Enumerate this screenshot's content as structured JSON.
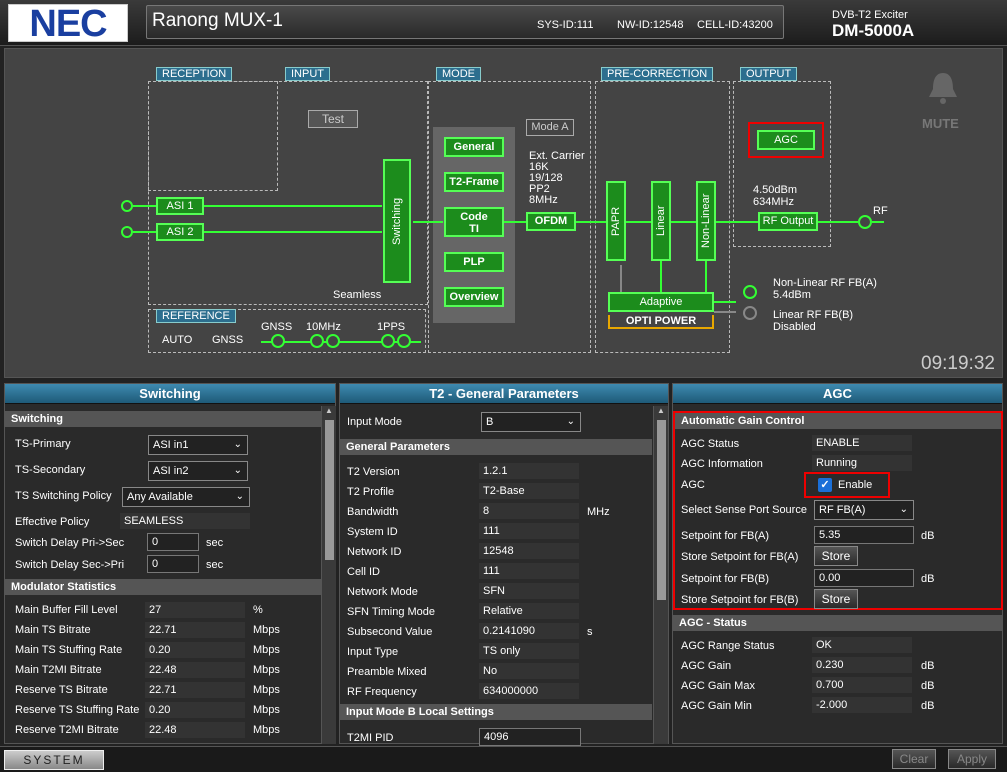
{
  "header": {
    "logo": "NEC",
    "site": "Ranong MUX-1",
    "sys_id": "SYS-ID:111",
    "nw_id": "NW-ID:12548",
    "cell_id": "CELL-ID:43200",
    "model_sub": "DVB-T2 Exciter",
    "model": "DM-5000A"
  },
  "diagram": {
    "sections": {
      "reception": "RECEPTION",
      "input": "INPUT",
      "mode": "MODE",
      "precorrection": "PRE-CORRECTION",
      "output": "OUTPUT",
      "reference": "REFERENCE"
    },
    "test": "Test",
    "asi1": "ASI 1",
    "asi2": "ASI 2",
    "switching": "Switching",
    "seamless": "Seamless",
    "mode_a": "Mode A",
    "general": "General",
    "t2frame": "T2-Frame",
    "code_ti_1": "Code",
    "code_ti_2": "TI",
    "plp": "PLP",
    "overview": "Overview",
    "carrier": [
      "Ext. Carrier",
      "16K",
      "19/128",
      "PP2",
      "8MHz"
    ],
    "ofdm": "OFDM",
    "papr": "PAPR",
    "linear": "Linear",
    "nonlinear": "Non-Linear",
    "adaptive": "Adaptive",
    "optipower": "OPTI POWER",
    "agc": "AGC",
    "out_level": "4.50dBm",
    "out_freq": "634MHz",
    "rf_output": "RF Output",
    "rf": "RF",
    "nl_fb": "Non-Linear RF FB(A)",
    "nl_fb_level": "5.4dBm",
    "l_fb": "Linear RF FB(B)",
    "l_fb_state": "Disabled",
    "mute": "MUTE",
    "ref_auto": "AUTO",
    "ref_gnss": "GNSS",
    "in_gnss": "GNSS",
    "in_10mhz": "10MHz",
    "in_1pps": "1PPS",
    "clock": "09:19:32"
  },
  "switching": {
    "title": "Switching",
    "section": "Switching",
    "ts_primary_label": "TS-Primary",
    "ts_primary": "ASI in1",
    "ts_secondary_label": "TS-Secondary",
    "ts_secondary": "ASI in2",
    "policy_label": "TS Switching Policy",
    "policy": "Any Available",
    "eff_policy_label": "Effective Policy",
    "eff_policy": "SEAMLESS",
    "delay_ps_label": "Switch Delay Pri->Sec",
    "delay_ps": "0",
    "delay_ps_unit": "sec",
    "delay_sp_label": "Switch Delay Sec->Pri",
    "delay_sp": "0",
    "delay_sp_unit": "sec",
    "stats_section": "Modulator Statistics",
    "stats": [
      {
        "label": "Main Buffer Fill Level",
        "value": "27",
        "unit": "%"
      },
      {
        "label": "Main TS Bitrate",
        "value": "22.71",
        "unit": "Mbps"
      },
      {
        "label": "Main TS Stuffing Rate",
        "value": "0.20",
        "unit": "Mbps"
      },
      {
        "label": "Main T2MI Bitrate",
        "value": "22.48",
        "unit": "Mbps"
      },
      {
        "label": "Reserve TS Bitrate",
        "value": "22.71",
        "unit": "Mbps"
      },
      {
        "label": "Reserve TS Stuffing Rate",
        "value": "0.20",
        "unit": "Mbps"
      },
      {
        "label": "Reserve T2MI Bitrate",
        "value": "22.48",
        "unit": "Mbps"
      }
    ]
  },
  "t2": {
    "title": "T2 - General Parameters",
    "input_mode_label": "Input Mode",
    "input_mode": "B",
    "section": "General Parameters",
    "params": [
      {
        "label": "T2 Version",
        "value": "1.2.1",
        "unit": ""
      },
      {
        "label": "T2 Profile",
        "value": "T2-Base",
        "unit": ""
      },
      {
        "label": "Bandwidth",
        "value": "8",
        "unit": "MHz"
      },
      {
        "label": "System ID",
        "value": "111",
        "unit": ""
      },
      {
        "label": "Network ID",
        "value": "12548",
        "unit": ""
      },
      {
        "label": "Cell ID",
        "value": "111",
        "unit": ""
      },
      {
        "label": "Network Mode",
        "value": "SFN",
        "unit": ""
      },
      {
        "label": "SFN Timing Mode",
        "value": "Relative",
        "unit": ""
      },
      {
        "label": "Subsecond Value",
        "value": "0.2141090",
        "unit": "s"
      },
      {
        "label": "Input Type",
        "value": "TS only",
        "unit": ""
      },
      {
        "label": "Preamble Mixed",
        "value": "No",
        "unit": ""
      },
      {
        "label": "RF Frequency",
        "value": "634000000",
        "unit": ""
      }
    ],
    "section2": "Input Mode B Local Settings",
    "t2mi_pid_label": "T2MI PID",
    "t2mi_pid": "4096"
  },
  "agc": {
    "title": "AGC",
    "section": "Automatic Gain Control",
    "status_label": "AGC Status",
    "status": "ENABLE",
    "info_label": "AGC Information",
    "info": "Running",
    "agc_label": "AGC",
    "enable_label": "Enable",
    "sense_label": "Select Sense Port Source",
    "sense": "RF FB(A)",
    "sp_a_label": "Setpoint for FB(A)",
    "sp_a": "5.35",
    "sp_a_unit": "dB",
    "store_a_label": "Store Setpoint for FB(A)",
    "store": "Store",
    "sp_b_label": "Setpoint for FB(B)",
    "sp_b": "0.00",
    "sp_b_unit": "dB",
    "store_b_label": "Store Setpoint for FB(B)",
    "status_section": "AGC - Status",
    "range_label": "AGC Range Status",
    "range": "OK",
    "gain_label": "AGC Gain",
    "gain": "0.230",
    "gain_unit": "dB",
    "gmax_label": "AGC Gain Max",
    "gmax": "0.700",
    "gmax_unit": "dB",
    "gmin_label": "AGC Gain Min",
    "gmin": "-2.000",
    "gmin_unit": "dB"
  },
  "footer": {
    "system": "SYSTEM",
    "clear": "Clear",
    "apply": "Apply"
  }
}
